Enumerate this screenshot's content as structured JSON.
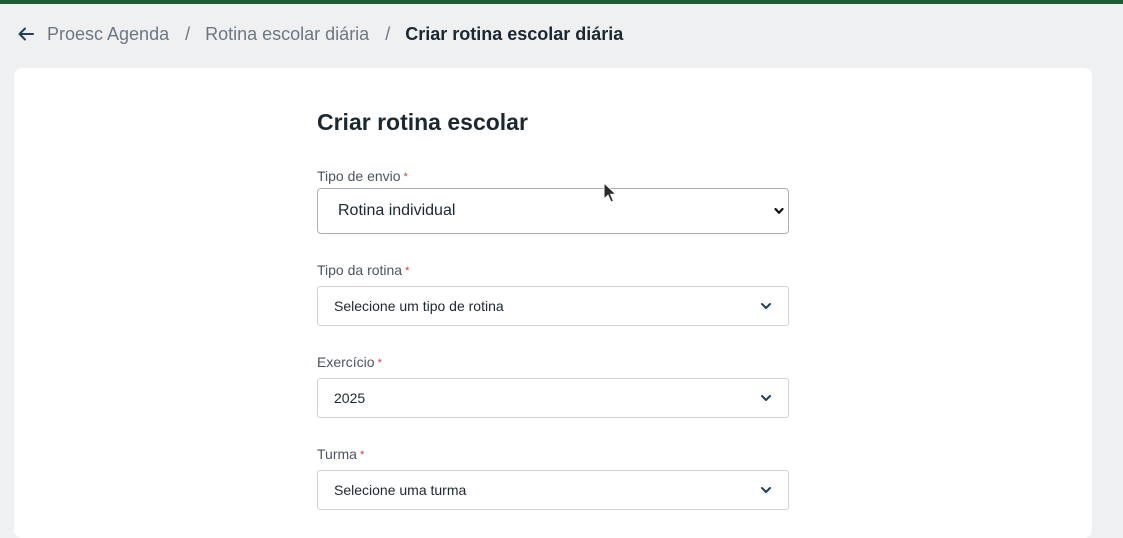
{
  "breadcrumb": {
    "items": [
      "Proesc Agenda",
      "Rotina escolar diária"
    ],
    "separator": "/",
    "current": "Criar rotina escolar diária"
  },
  "form": {
    "title": "Criar rotina escolar",
    "required_mark": "*",
    "tipo_envio": {
      "label": "Tipo de envio",
      "value": "Rotina individual"
    },
    "tipo_rotina": {
      "label": "Tipo da rotina",
      "placeholder": "Selecione um tipo de rotina"
    },
    "exercicio": {
      "label": "Exercício",
      "value": "2025"
    },
    "turma": {
      "label": "Turma",
      "placeholder": "Selecione uma turma"
    }
  },
  "icons": {
    "back": "arrow-left-icon",
    "dropdown": "chevron-down-icon",
    "cursor": "mouse-pointer-icon"
  },
  "colors": {
    "accent_bar": "#1d5c35",
    "chevron": "#1f3f5a",
    "required": "#d33b3b"
  }
}
